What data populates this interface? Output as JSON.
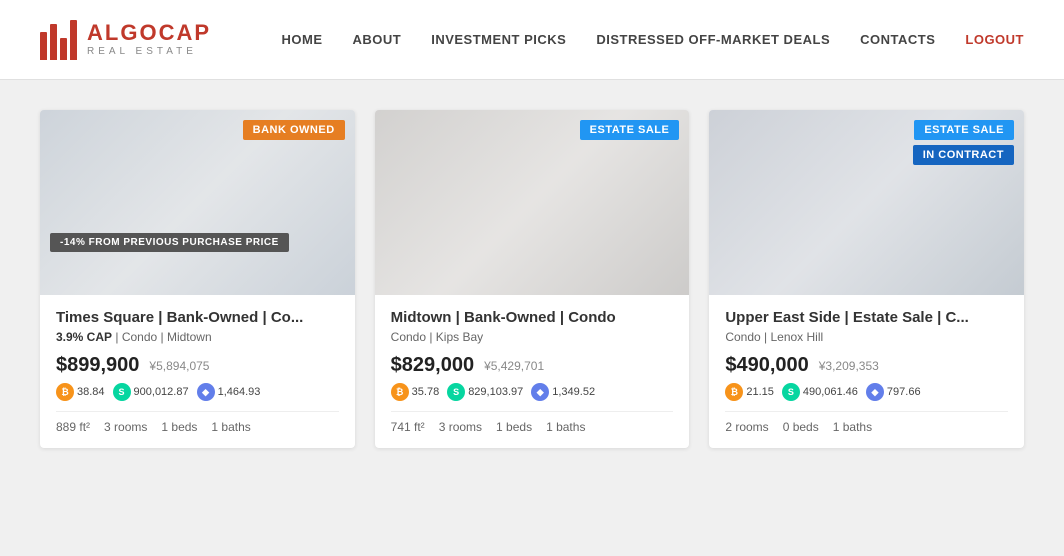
{
  "header": {
    "logo_main_part1": "ALGO",
    "logo_main_part2": "CAP",
    "logo_sub": "REAL  ESTATE",
    "nav": [
      {
        "label": "HOME",
        "id": "home"
      },
      {
        "label": "ABOUT",
        "id": "about"
      },
      {
        "label": "INVESTMENT PICKS",
        "id": "investment-picks"
      },
      {
        "label": "DISTRESSED OFF-MARKET DEALS",
        "id": "distressed"
      },
      {
        "label": "CONTACTS",
        "id": "contacts"
      },
      {
        "label": "LOGOUT",
        "id": "logout"
      }
    ]
  },
  "cards": [
    {
      "id": "card1",
      "badge1": {
        "text": "BANK OWNED",
        "color": "orange"
      },
      "badge2": {
        "text": "-14% FROM PREVIOUS PURCHASE PRICE",
        "color": "dark"
      },
      "title": "Times Square | Bank-Owned | Co...",
      "subtitle_bold": "3.9% CAP",
      "subtitle": " | Condo | Midtown",
      "price": "$899,900",
      "yen": "¥5,894,075",
      "btc": "38.84",
      "steem": "900,012.87",
      "eth": "1,464.93",
      "sqft": "889 ft²",
      "rooms": "3 rooms",
      "beds": "1 beds",
      "baths": "1 baths"
    },
    {
      "id": "card2",
      "badge1": {
        "text": "ESTATE SALE",
        "color": "blue"
      },
      "badge2": null,
      "title": "Midtown | Bank-Owned | Condo",
      "subtitle_bold": "",
      "subtitle": "Condo | Kips Bay",
      "price": "$829,000",
      "yen": "¥5,429,701",
      "btc": "35.78",
      "steem": "829,103.97",
      "eth": "1,349.52",
      "sqft": "741 ft²",
      "rooms": "3 rooms",
      "beds": "1 beds",
      "baths": "1 baths"
    },
    {
      "id": "card3",
      "badge1": {
        "text": "ESTATE SALE",
        "color": "blue"
      },
      "badge2": {
        "text": "IN CONTRACT",
        "color": "darkblue"
      },
      "title": "Upper East Side | Estate Sale | C...",
      "subtitle_bold": "",
      "subtitle": "Condo | Lenox Hill",
      "price": "$490,000",
      "yen": "¥3,209,353",
      "btc": "21.15",
      "steem": "490,061.46",
      "eth": "797.66",
      "sqft": null,
      "rooms": "2 rooms",
      "beds": "0 beds",
      "baths": "1 baths"
    }
  ]
}
